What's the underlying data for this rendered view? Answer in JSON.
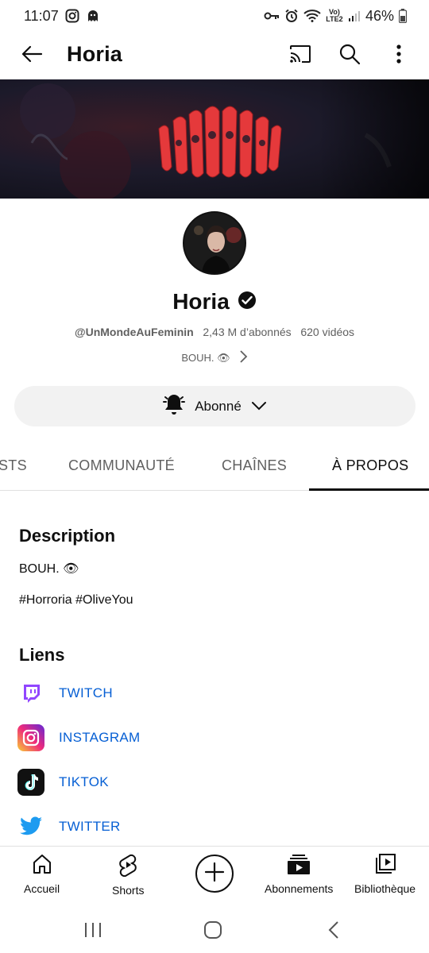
{
  "status_bar": {
    "time": "11:07",
    "network": "Vo) LTE2",
    "battery": "46%"
  },
  "app_bar": {
    "title": "Horia",
    "back_icon": "arrow-left-icon",
    "cast_icon": "cast-icon",
    "search_icon": "search-icon",
    "more_icon": "more-vert-icon"
  },
  "banner": {
    "logo_text": "HORRORIA",
    "accent_color": "#e5393b"
  },
  "channel": {
    "name": "Horia",
    "verified_icon": "verified-check-icon",
    "handle": "@UnMondeAuFeminin",
    "subscribers": "2,43 M d’abonnés",
    "videos": "620 vidéos",
    "tagline": "BOUH. 👁",
    "subscribe_label": "Abonné"
  },
  "tabs": [
    {
      "label": "STS",
      "active": false
    },
    {
      "label": "COMMUNAUTÉ",
      "active": false
    },
    {
      "label": "CHAÎNES",
      "active": false
    },
    {
      "label": "À PROPOS",
      "active": true
    }
  ],
  "about": {
    "description_title": "Description",
    "description_line1": "BOUH. 👁",
    "description_line2": "#Horroria #OliveYou",
    "links_title": "Liens",
    "links": [
      {
        "label": "TWITCH",
        "icon": "twitch-icon",
        "color": "#9146ff"
      },
      {
        "label": "INSTAGRAM",
        "icon": "instagram-icon",
        "color": "#e1306c"
      },
      {
        "label": "TIKTOK",
        "icon": "tiktok-icon",
        "color": "#111111"
      },
      {
        "label": "TWITTER",
        "icon": "twitter-icon",
        "color": "#1d9bf0"
      }
    ]
  },
  "bottom_nav": {
    "home": "Accueil",
    "shorts": "Shorts",
    "create_icon": "plus-circle-icon",
    "subscriptions": "Abonnements",
    "library": "Bibliothèque"
  },
  "colors": {
    "link_blue": "#065fd4",
    "text_secondary": "#606060",
    "chip_bg": "#f2f2f2"
  }
}
